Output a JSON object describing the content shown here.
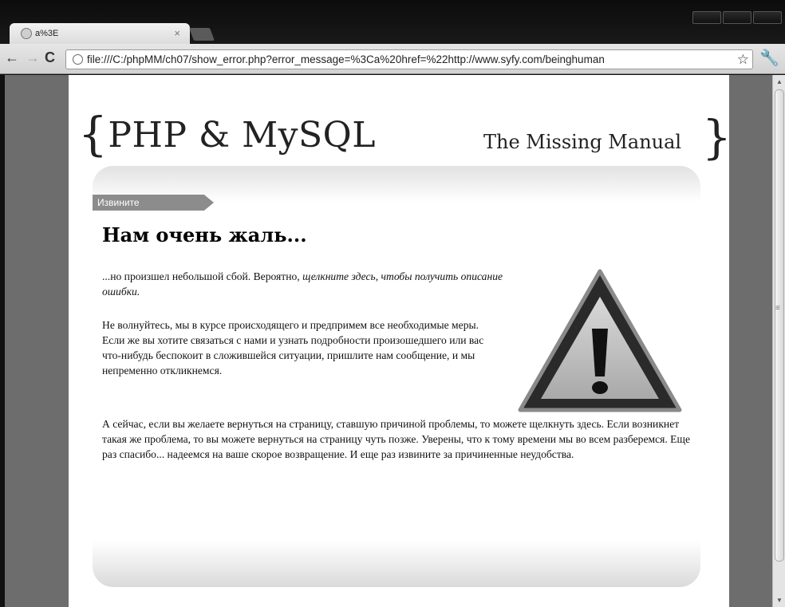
{
  "browser": {
    "tab_title": "a%3E",
    "tab_close": "×",
    "url": "file:///C:/phpMM/ch07/show_error.php?error_message=%3Ca%20href=%22http://www.syfy.com/beinghuman"
  },
  "site": {
    "brace_left": "{",
    "title": "PHP & MySQL",
    "subtitle": "The Missing Manual",
    "brace_right": "}"
  },
  "content": {
    "ribbon": "Извините",
    "heading": "Нам очень жаль...",
    "p1_text": "...но произшел небольшой сбой. Вероятно, ",
    "p1_link": "щелкните здесь, чтобы получить описание ошибки.",
    "p2": "Не волнуйтесь, мы в курсе происходящего и предпримем все необходимые меры. Если же вы хотите связаться с нами и узнать подробности произошедшего или вас что-нибудь беспокоит в сложившейся ситуации, пришлите нам сообщение, и мы непременно откликнемся.",
    "p3": "А сейчас, если вы желаете вернуться на страницу, ставшую причиной проблемы, то можете щелкнуть здесь. Если возникнет такая же проблема, то вы можете вернуться на страницу чуть позже. Уверены, что к тому времени мы во всем разберемся. Еще раз спасибо... надеемся на ваше скорое возвращение. И еще раз извините за причиненные неудобства."
  },
  "icons": {
    "warning": "warning-triangle-icon",
    "favicon": "globe-icon",
    "star": "star-icon",
    "wrench": "wrench-icon"
  }
}
